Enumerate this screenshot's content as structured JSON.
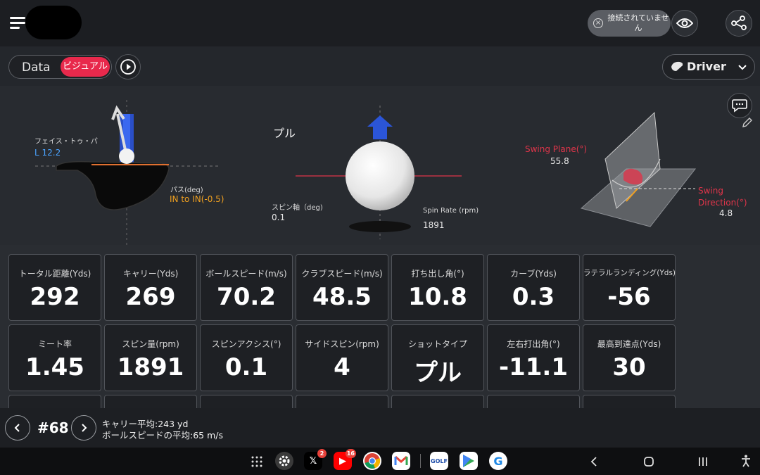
{
  "header": {
    "connection_status": "接続されていません"
  },
  "toolbar": {
    "tab_data": "Data",
    "tab_visual": "ビジュアル",
    "club": "Driver"
  },
  "visual": {
    "club_face": {
      "label": "フェイス・トゥ・パ",
      "value": "L 12.2"
    },
    "path": {
      "label": "パス(deg)",
      "value": "IN to IN(-0.5)"
    },
    "shot_shape": "プル",
    "spin_axis": {
      "label": "スピン軸（deg)",
      "value": "0.1"
    },
    "spin_rate": {
      "label": "Spin Rate (rpm)",
      "value": "1891"
    },
    "swing_plane": {
      "label": "Swing Plane(°)",
      "value": "55.8"
    },
    "swing_direction": {
      "label1": "Swing",
      "label2": "Direction(°)",
      "value": "4.8"
    }
  },
  "metrics": [
    {
      "label": "トータル距離(Yds)",
      "value": "292"
    },
    {
      "label": "キャリー(Yds)",
      "value": "269"
    },
    {
      "label": "ボールスピード(m/s)",
      "value": "70.2"
    },
    {
      "label": "クラブスピード(m/s)",
      "value": "48.5"
    },
    {
      "label": "打ち出し角(°)",
      "value": "10.8"
    },
    {
      "label": "カーブ(Yds)",
      "value": "0.3"
    },
    {
      "label": "ラテラルランディング(Yds)",
      "value": "-56"
    },
    {
      "label": "ミート率",
      "value": "1.45"
    },
    {
      "label": "スピン量(rpm)",
      "value": "1891"
    },
    {
      "label": "スピンアクシス(°)",
      "value": "0.1"
    },
    {
      "label": "サイドスピン(rpm)",
      "value": "4"
    },
    {
      "label": "ショットタイプ",
      "value": "プル"
    },
    {
      "label": "左右打出角(°)",
      "value": "-11.1"
    },
    {
      "label": "最高到達点(Yds)",
      "value": "30"
    }
  ],
  "footer": {
    "shot_number": "#68",
    "carry_avg": "キャリー平均:243 yd",
    "ball_speed_avg": "ボールスピードの平均:65 m/s"
  },
  "taskbar": {
    "x_badge": "2",
    "youtube_badge": "16"
  },
  "colors": {
    "accent": "#e8294c",
    "blue_value": "#4aa3ff",
    "orange_value": "#f0a020",
    "red_label": "#e0354a"
  },
  "icons": [
    "menu-icon",
    "eye-icon",
    "share-icon",
    "play-icon",
    "chevron-down-icon",
    "chat-icon",
    "pencil-icon",
    "chevron-left-icon",
    "chevron-right-icon"
  ]
}
